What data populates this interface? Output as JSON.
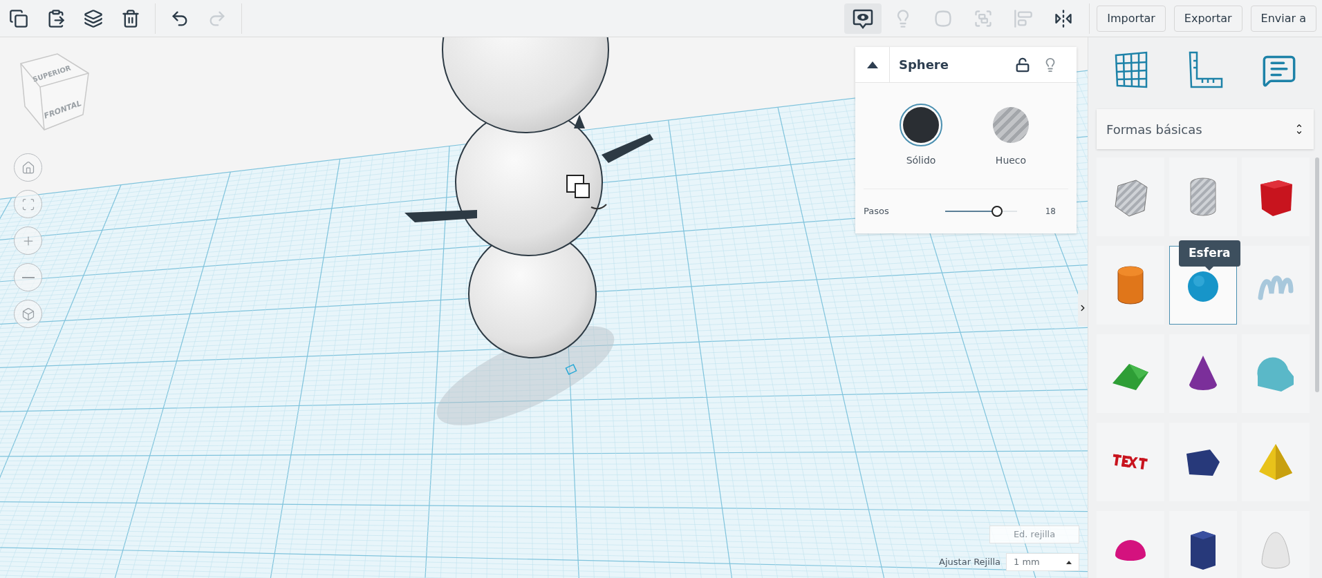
{
  "toolbar": {
    "left_tools": [
      {
        "kind": "copy",
        "disabled": false
      },
      {
        "kind": "paste",
        "disabled": false
      },
      {
        "kind": "duplicate",
        "disabled": false
      },
      {
        "kind": "delete",
        "disabled": false
      },
      {
        "kind": "undo",
        "disabled": false
      },
      {
        "kind": "redo",
        "disabled": true
      }
    ],
    "right_tools": [
      {
        "kind": "notes-toggle",
        "disabled": false
      },
      {
        "kind": "bulb",
        "disabled": true
      },
      {
        "kind": "group",
        "disabled": true
      },
      {
        "kind": "ungroup",
        "disabled": true
      },
      {
        "kind": "align",
        "disabled": true
      },
      {
        "kind": "mirror",
        "disabled": false
      }
    ],
    "buttons": [
      "Importar",
      "Exportar",
      "Enviar a"
    ]
  },
  "view_cube": {
    "top": "SUPERIOR",
    "front": "FRONTAL"
  },
  "view_controls": [
    {
      "kind": "home"
    },
    {
      "kind": "fit"
    },
    {
      "kind": "zoom-in"
    },
    {
      "kind": "zoom-out"
    },
    {
      "kind": "perspective"
    }
  ],
  "inspector": {
    "title": "Sphere",
    "locked": false,
    "options": [
      {
        "kind": "solid",
        "label": "Sólido",
        "selected": true
      },
      {
        "kind": "hole",
        "label": "Hueco",
        "selected": false
      }
    ],
    "slider": {
      "label": "Pasos",
      "level": 0.72,
      "reading": "18"
    }
  },
  "grid": {
    "edit_button": "Ed. rejilla",
    "snap_label": "Ajustar Rejilla",
    "snap_value": "1 mm"
  },
  "library": {
    "tools": [
      {
        "kind": "workplane"
      },
      {
        "kind": "ruler"
      },
      {
        "kind": "notes"
      }
    ],
    "category": "Formas básicas",
    "tooltip": "Esfera",
    "shapes": [
      {
        "kind": "box-hole",
        "selected": false
      },
      {
        "kind": "cylinder-hole",
        "selected": false
      },
      {
        "kind": "box",
        "selected": false
      },
      {
        "kind": "cylinder",
        "selected": false
      },
      {
        "kind": "sphere",
        "selected": true
      },
      {
        "kind": "scribble",
        "selected": false
      },
      {
        "kind": "roof",
        "selected": false
      },
      {
        "kind": "cone",
        "selected": false
      },
      {
        "kind": "round-roof",
        "selected": false
      },
      {
        "kind": "text",
        "selected": false
      },
      {
        "kind": "wedge",
        "selected": false
      },
      {
        "kind": "pyramid",
        "selected": false
      },
      {
        "kind": "half-sphere",
        "selected": false
      },
      {
        "kind": "polygon",
        "selected": false
      },
      {
        "kind": "paraboloid",
        "selected": false
      }
    ]
  }
}
